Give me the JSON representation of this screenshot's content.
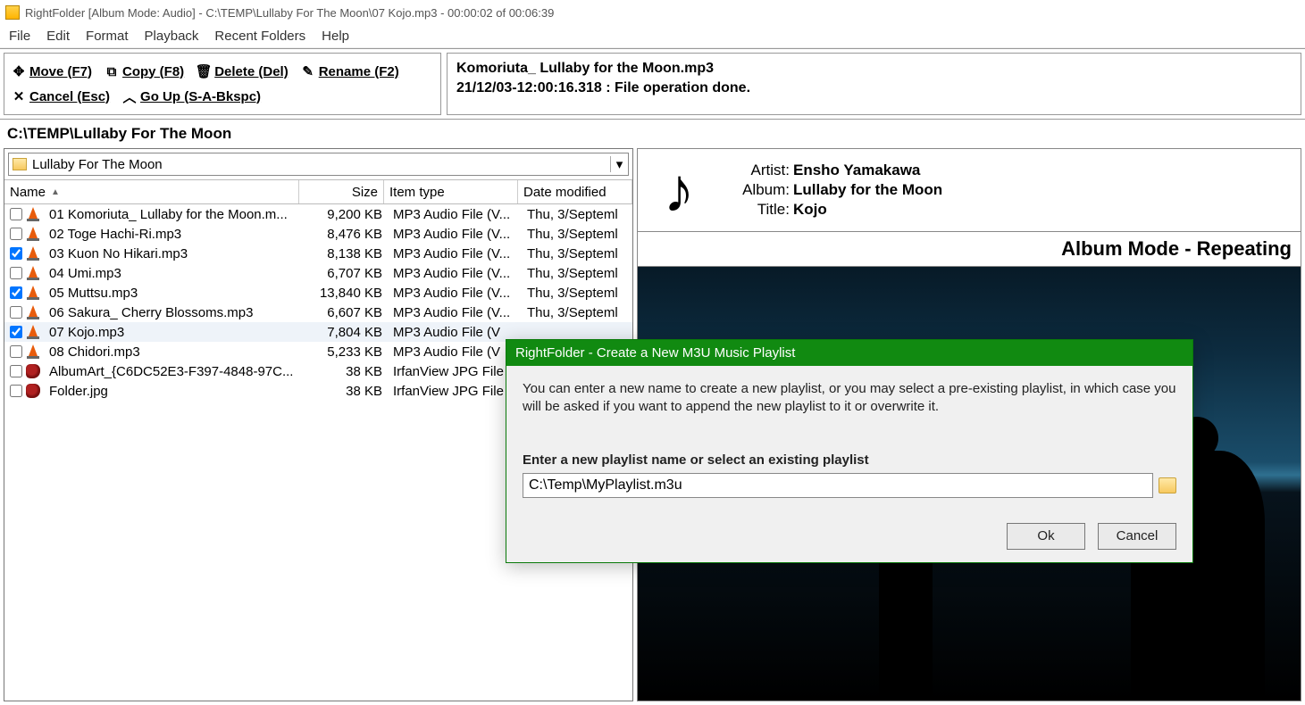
{
  "title": "RightFolder [Album Mode: Audio] - C:\\TEMP\\Lullaby For The Moon\\07 Kojo.mp3 - 00:00:02 of 00:06:39",
  "menu": {
    "items": [
      "File",
      "Edit",
      "Format",
      "Playback",
      "Recent Folders",
      "Help"
    ]
  },
  "toolbar": {
    "move": "Move (F7)",
    "copy": "Copy (F8)",
    "delete": "Delete (Del)",
    "rename": "Rename (F2)",
    "cancel": "Cancel (Esc)",
    "goup": "Go Up (S-A-Bkspc)"
  },
  "log": {
    "line1": "Komoriuta_ Lullaby for the Moon.mp3",
    "line2": "21/12/03-12:00:16.318 : File operation done."
  },
  "path": "C:\\TEMP\\Lullaby For The Moon",
  "folder_select": "Lullaby For The Moon",
  "columns": {
    "name": "Name",
    "size": "Size",
    "type": "Item type",
    "date": "Date modified"
  },
  "files": [
    {
      "chk": false,
      "icon": "vlc",
      "name": "01 Komoriuta_ Lullaby for the Moon.m...",
      "size": "9,200 KB",
      "type": "MP3 Audio File (V...",
      "date": "Thu, 3/Septeml"
    },
    {
      "chk": false,
      "icon": "vlc",
      "name": "02 Toge Hachi-Ri.mp3",
      "size": "8,476 KB",
      "type": "MP3 Audio File (V...",
      "date": "Thu, 3/Septeml"
    },
    {
      "chk": true,
      "icon": "vlc",
      "name": "03 Kuon No Hikari.mp3",
      "size": "8,138 KB",
      "type": "MP3 Audio File (V...",
      "date": "Thu, 3/Septeml"
    },
    {
      "chk": false,
      "icon": "vlc",
      "name": "04 Umi.mp3",
      "size": "6,707 KB",
      "type": "MP3 Audio File (V...",
      "date": "Thu, 3/Septeml"
    },
    {
      "chk": true,
      "icon": "vlc",
      "name": "05 Muttsu.mp3",
      "size": "13,840 KB",
      "type": "MP3 Audio File (V...",
      "date": "Thu, 3/Septeml"
    },
    {
      "chk": false,
      "icon": "vlc",
      "name": "06 Sakura_ Cherry Blossoms.mp3",
      "size": "6,607 KB",
      "type": "MP3 Audio File (V...",
      "date": "Thu, 3/Septeml"
    },
    {
      "chk": true,
      "icon": "vlc",
      "name": "07 Kojo.mp3",
      "size": "7,804 KB",
      "type": "MP3 Audio File (V",
      "date": "",
      "selected": true
    },
    {
      "chk": false,
      "icon": "vlc",
      "name": "08 Chidori.mp3",
      "size": "5,233 KB",
      "type": "MP3 Audio File (V",
      "date": ""
    },
    {
      "chk": false,
      "icon": "jpg",
      "name": "AlbumArt_{C6DC52E3-F397-4848-97C...",
      "size": "38 KB",
      "type": "IrfanView JPG File",
      "date": ""
    },
    {
      "chk": false,
      "icon": "jpg",
      "name": "Folder.jpg",
      "size": "38 KB",
      "type": "IrfanView JPG File",
      "date": ""
    }
  ],
  "meta": {
    "artist_label": "Artist:",
    "artist": "Ensho Yamakawa",
    "album_label": "Album:",
    "album": "Lullaby for the Moon",
    "title_label": "Title:",
    "title": "Kojo"
  },
  "mode": "Album Mode - Repeating",
  "dialog": {
    "title": "RightFolder - Create a New M3U Music Playlist",
    "text": "You can enter a new name to create a new playlist, or you may select a pre-existing playlist, in which case you will be asked if you want to append the new playlist to it or overwrite it.",
    "label": "Enter a new playlist name or select an existing playlist",
    "value": "C:\\Temp\\MyPlaylist.m3u",
    "ok": "Ok",
    "cancel": "Cancel"
  }
}
